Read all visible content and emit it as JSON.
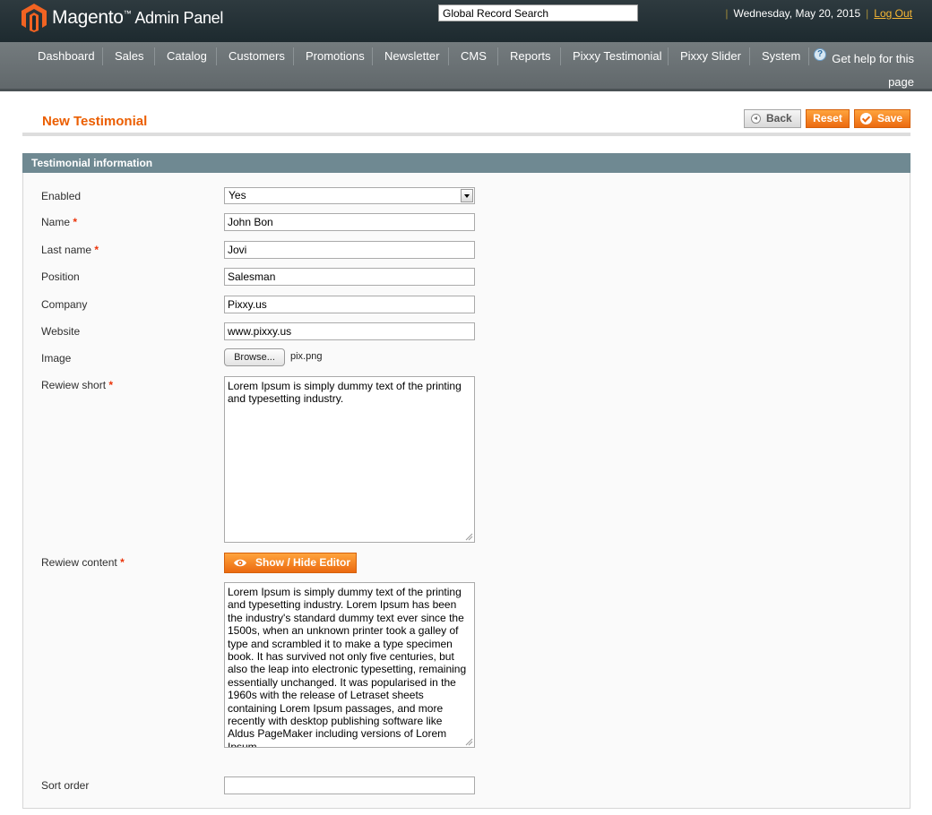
{
  "header": {
    "brand": "Magento",
    "brand_tm": "™",
    "brand_sub": "Admin Panel",
    "search_value": "Global Record Search",
    "date": "Wednesday, May 20, 2015",
    "logout": "Log Out"
  },
  "nav": {
    "items": [
      {
        "label": "Dashboard"
      },
      {
        "label": "Sales"
      },
      {
        "label": "Catalog"
      },
      {
        "label": "Customers"
      },
      {
        "label": "Promotions"
      },
      {
        "label": "Newsletter"
      },
      {
        "label": "CMS"
      },
      {
        "label": "Reports"
      },
      {
        "label": "Pixxy Testimonial"
      },
      {
        "label": "Pixxy Slider"
      },
      {
        "label": "System"
      }
    ],
    "help": "Get help for this page"
  },
  "page": {
    "title": "New Testimonial",
    "back": "Back",
    "reset": "Reset",
    "save": "Save"
  },
  "section": {
    "title": "Testimonial information"
  },
  "form": {
    "enabled": {
      "label": "Enabled",
      "value": "Yes"
    },
    "name": {
      "label": "Name",
      "value": "John Bon"
    },
    "last_name": {
      "label": "Last name",
      "value": "Jovi"
    },
    "position": {
      "label": "Position",
      "value": "Salesman"
    },
    "company": {
      "label": "Company",
      "value": "Pixxy.us"
    },
    "website": {
      "label": "Website",
      "value": "www.pixxy.us"
    },
    "image": {
      "label": "Image",
      "browse": "Browse...",
      "file": "pix.png"
    },
    "review_short": {
      "label": "Rewiew short",
      "value": "Lorem Ipsum is simply dummy text of the printing and typesetting industry."
    },
    "review_content": {
      "label": "Rewiew content",
      "editor_toggle": "Show / Hide Editor",
      "value": "Lorem Ipsum is simply dummy text of the printing and typesetting industry. Lorem Ipsum has been the industry's standard dummy text ever since the 1500s, when an unknown printer took a galley of type and scrambled it to make a type specimen book. It has survived not only five centuries, but also the leap into electronic typesetting, remaining essentially unchanged. It was popularised in the 1960s with the release of Letraset sheets containing Lorem Ipsum passages, and more recently with desktop publishing software like Aldus PageMaker including versions of Lorem Ipsum."
    },
    "sort_order": {
      "label": "Sort order",
      "value": ""
    },
    "required_mark": "*"
  },
  "colors": {
    "accent": "#eb5e00",
    "header_bg": "#1d2a2f",
    "nav_bg": "#6b7275",
    "section_head": "#6f8992"
  }
}
